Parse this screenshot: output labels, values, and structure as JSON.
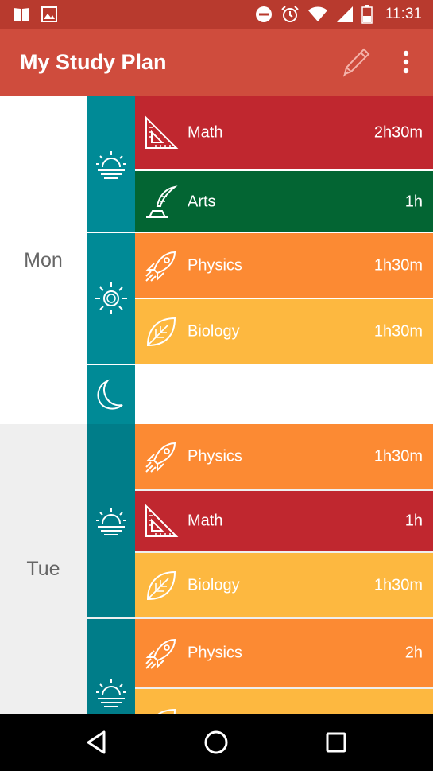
{
  "status_bar": {
    "time": "11:31",
    "icons_left": [
      "book-icon",
      "image-icon"
    ],
    "icons_right": [
      "do-not-disturb-icon",
      "alarm-icon",
      "wifi-icon",
      "signal-icon",
      "battery-icon"
    ]
  },
  "app_bar": {
    "title": "My Study Plan",
    "edit_icon": "pencil-icon",
    "menu_icon": "more-vert-icon"
  },
  "days": [
    {
      "label": "Mon",
      "periods": [
        {
          "icon": "sunrise-icon",
          "sessions": [
            {
              "subject": "Math",
              "duration": "2h30m",
              "icon": "set-square-icon",
              "color": "#c0272f"
            },
            {
              "subject": "Arts",
              "duration": "1h",
              "icon": "quill-icon",
              "color": "#036533"
            }
          ]
        },
        {
          "icon": "sun-icon",
          "sessions": [
            {
              "subject": "Physics",
              "duration": "1h30m",
              "icon": "rocket-icon",
              "color": "#fc8a33"
            },
            {
              "subject": "Biology",
              "duration": "1h30m",
              "icon": "leaf-icon",
              "color": "#fdb840"
            }
          ]
        },
        {
          "icon": "moon-icon",
          "sessions": []
        }
      ]
    },
    {
      "label": "Tue",
      "periods": [
        {
          "icon": "sunrise-icon",
          "sessions": [
            {
              "subject": "Physics",
              "duration": "1h30m",
              "icon": "rocket-icon",
              "color": "#fc8a33"
            },
            {
              "subject": "Math",
              "duration": "1h",
              "icon": "set-square-icon",
              "color": "#c0272f"
            },
            {
              "subject": "Biology",
              "duration": "1h30m",
              "icon": "leaf-icon",
              "color": "#fdb840"
            }
          ]
        },
        {
          "icon": "sun-icon",
          "sessions": [
            {
              "subject": "Physics",
              "duration": "2h",
              "icon": "rocket-icon",
              "color": "#fc8a33"
            }
          ]
        }
      ]
    }
  ],
  "nav_bar": {
    "back": "back-icon",
    "home": "home-icon",
    "recents": "recents-icon"
  },
  "colors": {
    "status_bar": "#b83a2e",
    "app_bar": "#cf4c3d",
    "teal": "#008a96",
    "math": "#c0272f",
    "arts": "#036533",
    "physics": "#fc8a33",
    "biology": "#fdb840"
  }
}
